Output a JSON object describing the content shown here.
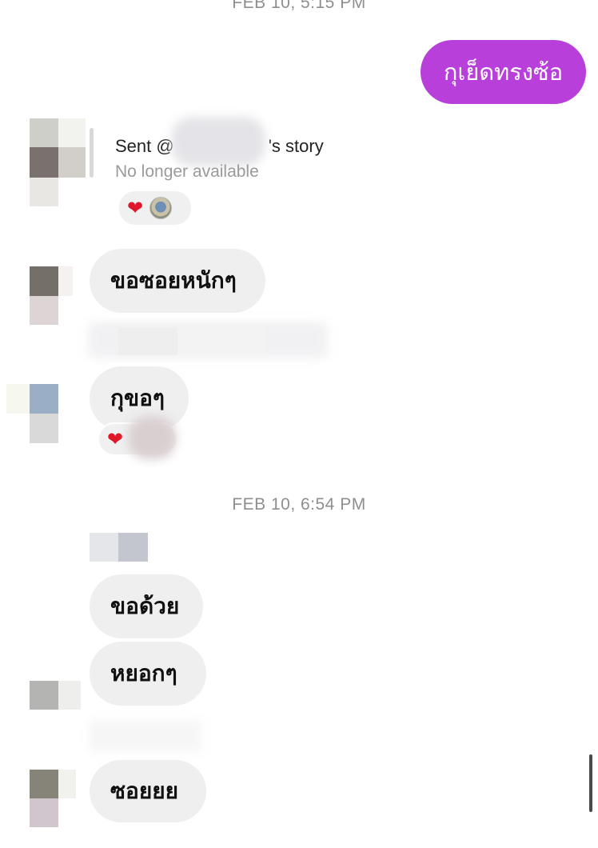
{
  "timestamps": {
    "first": "FEB 10, 5:15 PM",
    "second": "FEB 10, 6:54 PM"
  },
  "outgoing_message": {
    "text": "กุเย็ดทรงซ้อ"
  },
  "story_reply": {
    "sent_prefix": "Sent @",
    "sent_suffix": "'s story",
    "status": "No longer available",
    "reactions": [
      "heart-icon",
      "avatar-icon"
    ]
  },
  "incoming_messages": [
    {
      "text": "ขอซอยหนักๆ"
    },
    {
      "text": "กุขอๆ",
      "reaction": "heart-icon"
    },
    {
      "text": "ขอด้วย"
    },
    {
      "text": "หยอกๆ"
    },
    {
      "text": "ซอยยย"
    }
  ],
  "colors": {
    "outgoing_bubble": "#b83fd9",
    "incoming_bubble": "#efefef",
    "timestamp": "#8e8e8e",
    "heart": "#e0162b"
  }
}
